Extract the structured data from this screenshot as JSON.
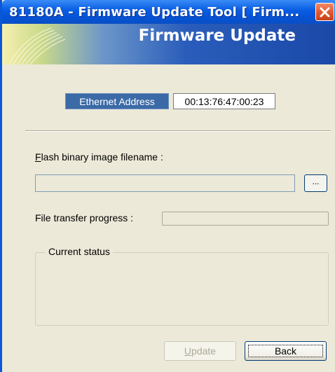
{
  "window": {
    "title": "81180A - Firmware Update Tool [ Firm...",
    "close_icon": "close-icon"
  },
  "banner": {
    "title": "Firmware Update"
  },
  "ethernet": {
    "label": "Ethernet Address",
    "value": "00:13:76:47:00:23"
  },
  "flash": {
    "label_access_key": "F",
    "label_rest": "lash binary image filename :",
    "value": "",
    "browse_label": "..."
  },
  "progress": {
    "label": "File transfer progress :",
    "percent": 0
  },
  "status": {
    "legend": "Current status",
    "text": ""
  },
  "buttons": {
    "update_access_key": "U",
    "update_rest": "pdate",
    "back_label": "Back"
  },
  "colors": {
    "title_bar": "#0a5fe4",
    "close_button": "#e25a30",
    "ethernet_label_bg": "#3b6aa6",
    "window_bg": "#ece9d8"
  }
}
